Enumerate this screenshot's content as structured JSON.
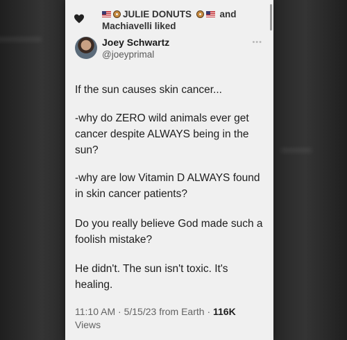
{
  "social_context": {
    "flag_emoji_name": "us-flag-icon",
    "donut_emoji_name": "donut-icon",
    "liker_one": "JULIE DONUTS",
    "conjunction": "and",
    "liker_two_line": "Machiavelli liked"
  },
  "author": {
    "name": "Joey Schwartz",
    "handle": "@joeyprimal"
  },
  "tweet": {
    "paragraphs": [
      "If the sun causes skin cancer...",
      "-why do ZERO wild animals ever get cancer despite ALWAYS being in the sun?",
      "-why are low Vitamin D ALWAYS found in skin cancer patients?",
      "Do you really believe God made such a foolish mistake?",
      "He didn't. The sun isn't toxic. It's healing."
    ]
  },
  "meta": {
    "time": "11:10 AM",
    "date": "5/15/23",
    "source": "from Earth",
    "separator": "·",
    "views_count": "116K",
    "views_label": "Views"
  },
  "colors": {
    "card_bg": "#f0f0f0",
    "text_primary": "#1d1d1d",
    "text_secondary": "#636363",
    "heart": "#222222"
  }
}
